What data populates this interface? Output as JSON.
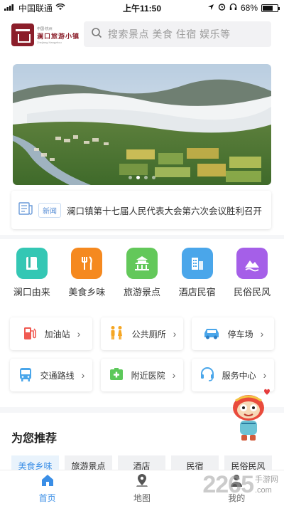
{
  "status_bar": {
    "carrier": "中国联通",
    "time": "上午11:50",
    "battery": "68%",
    "battery_level": 0.68
  },
  "header": {
    "logo_line1": "中国·杭州",
    "logo_line2": "澜口旅游小镇",
    "logo_line3": "Zhejiang Hangzhou",
    "search_placeholder": "搜索景点 美食 住宿 娱乐等"
  },
  "banner": {
    "slide_count": 4,
    "active_slide": 1
  },
  "news": {
    "tag": "新闻",
    "text": "澜口镇第十七届人民代表大会第六次会议胜利召开"
  },
  "categories": [
    {
      "label": "澜口由来",
      "icon": "book-icon",
      "color": "#34c7b4"
    },
    {
      "label": "美食乡味",
      "icon": "fork-knife-icon",
      "color": "#f5891f"
    },
    {
      "label": "旅游景点",
      "icon": "temple-icon",
      "color": "#63c85a"
    },
    {
      "label": "酒店民宿",
      "icon": "hotel-icon",
      "color": "#4aa6ea"
    },
    {
      "label": "民俗民风",
      "icon": "mountain-icon",
      "color": "#a55fe8"
    }
  ],
  "services": [
    {
      "label": "加油站",
      "icon": "gas-station-icon",
      "color": "#f05a52"
    },
    {
      "label": "公共厕所",
      "icon": "restroom-icon",
      "color": "#f5a623"
    },
    {
      "label": "停车场",
      "icon": "car-icon",
      "color": "#4aa6ea"
    },
    {
      "label": "交通路线",
      "icon": "bus-icon",
      "color": "#4aa6ea"
    },
    {
      "label": "附近医院",
      "icon": "hospital-icon",
      "color": "#5cc85a"
    },
    {
      "label": "服务中心",
      "icon": "headset-icon",
      "color": "#4aa6ea"
    }
  ],
  "recommend": {
    "title": "为您推荐",
    "tabs": [
      "美食乡味",
      "旅游景点",
      "酒店",
      "民宿",
      "民俗民风"
    ],
    "active_tab": 0
  },
  "tabbar": {
    "items": [
      {
        "label": "首页",
        "icon": "home-icon"
      },
      {
        "label": "地图",
        "icon": "map-pin-icon"
      },
      {
        "label": "我的",
        "icon": "user-icon"
      }
    ],
    "active": 0
  },
  "watermark": {
    "number": "2265",
    "line1": "手游网",
    "line2": ".com"
  },
  "colors": {
    "accent": "#3a8ee6",
    "brand": "#8b1e2a"
  }
}
